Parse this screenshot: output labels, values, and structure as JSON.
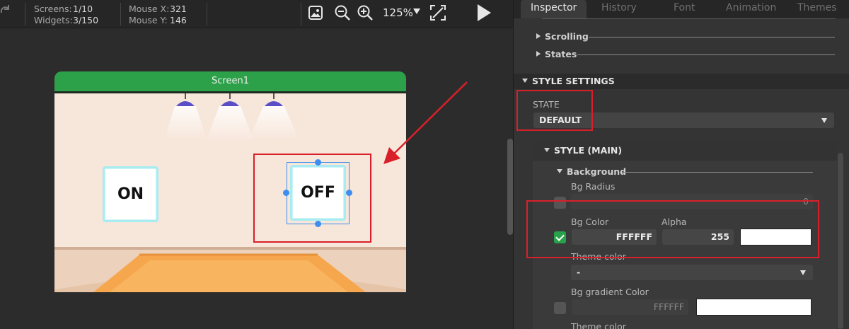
{
  "toolbar": {
    "screens_label": "Screens:",
    "screens_value": "1/10",
    "widgets_label": "Widgets:",
    "widgets_value": "3/150",
    "mouse_x_label": "Mouse X:",
    "mouse_x_value": "321",
    "mouse_y_label": "Mouse Y:",
    "mouse_y_value": "146",
    "zoom": "125%",
    "icons": [
      "redo-icon",
      "image-icon",
      "zoom-out-icon",
      "zoom-in-icon",
      "fit-screen-icon",
      "play-icon"
    ]
  },
  "canvas": {
    "screen_name": "Screen1",
    "widgets": [
      {
        "label": "ON"
      },
      {
        "label": "OFF"
      }
    ],
    "colors": {
      "screen_tab": "#2da14a",
      "selection": "#3d8ef0",
      "highlight": "#d9202a"
    }
  },
  "tabs": [
    "Inspector",
    "History",
    "Font",
    "Animation",
    "Themes"
  ],
  "inspector": {
    "tree": [
      "Scrolling",
      "States"
    ],
    "style_settings_title": "STYLE SETTINGS",
    "state_label": "STATE",
    "state_value": "DEFAULT",
    "style_main_title": "STYLE (MAIN)",
    "background_title": "Background",
    "bg_radius_label": "Bg Radius",
    "bg_radius_value": "0",
    "bg_color_label": "Bg Color",
    "bg_color_value": "FFFFFF",
    "alpha_label": "Alpha",
    "alpha_value": "255",
    "bg_color_enabled": true,
    "theme_color_label": "Theme color",
    "theme_color_value": "-",
    "bg_gradient_label": "Bg gradient Color",
    "bg_gradient_value": "FFFFFF",
    "theme_color_label_2": "Theme color"
  }
}
